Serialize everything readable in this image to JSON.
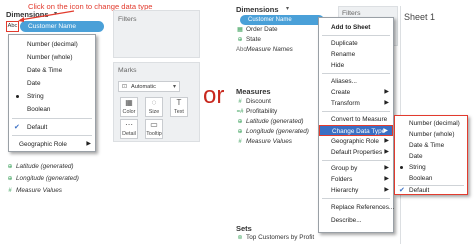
{
  "left": {
    "dimensions_title": "Dimensions",
    "abc_icon": "Abc",
    "pill_label": "Customer Name",
    "annotation": "Click on the icon to change data type",
    "filters_title": "Filters",
    "marks_title": "Marks",
    "marks_dropdown": "Automatic",
    "mark_buttons": [
      {
        "glyph": "▦",
        "label": "Color"
      },
      {
        "glyph": "◌",
        "label": "Size"
      },
      {
        "glyph": "T",
        "label": "Text"
      },
      {
        "glyph": "⋯",
        "label": "Detail"
      },
      {
        "glyph": "▭",
        "label": "Tooltip"
      }
    ],
    "menu_items": [
      "Number (decimal)",
      "Number (whole)",
      "Date & Time",
      "Date",
      "String",
      "Boolean",
      "Default",
      "Geographic Role"
    ],
    "fields": [
      "Latitude (generated)",
      "Longitude (generated)",
      "Measure Values"
    ]
  },
  "or_text": "or",
  "right": {
    "dimensions_title": "Dimensions",
    "pill_label": "Customer Name",
    "dim_fields": [
      "Order Date",
      "State",
      "Measure Names"
    ],
    "filters_title": "Filters",
    "sheet_title": "Sheet 1",
    "measures_title": "Measures",
    "measure_fields": [
      "Discount",
      "Profitability",
      "Latitude (generated)",
      "Longitude (generated)",
      "Measure Values"
    ],
    "sets_title": "Sets",
    "set_fields": [
      "Top Customers by Profit"
    ],
    "context_menu": [
      "Add to Sheet",
      "Duplicate",
      "Rename",
      "Hide",
      "Aliases...",
      "Create",
      "Transform",
      "Convert to Measure",
      "Change Data Type",
      "Geographic Role",
      "Default Properties",
      "Group by",
      "Folders",
      "Hierarchy",
      "Replace References...",
      "Describe..."
    ],
    "submenu": [
      "Number (decimal)",
      "Number (whole)",
      "Date & Time",
      "Date",
      "String",
      "Boolean",
      "Default"
    ]
  },
  "colors": {
    "accent": "#4aa0d8",
    "highlight": "#3a6fc4",
    "annotation": "#e23b2e",
    "or": "#c8281e"
  }
}
